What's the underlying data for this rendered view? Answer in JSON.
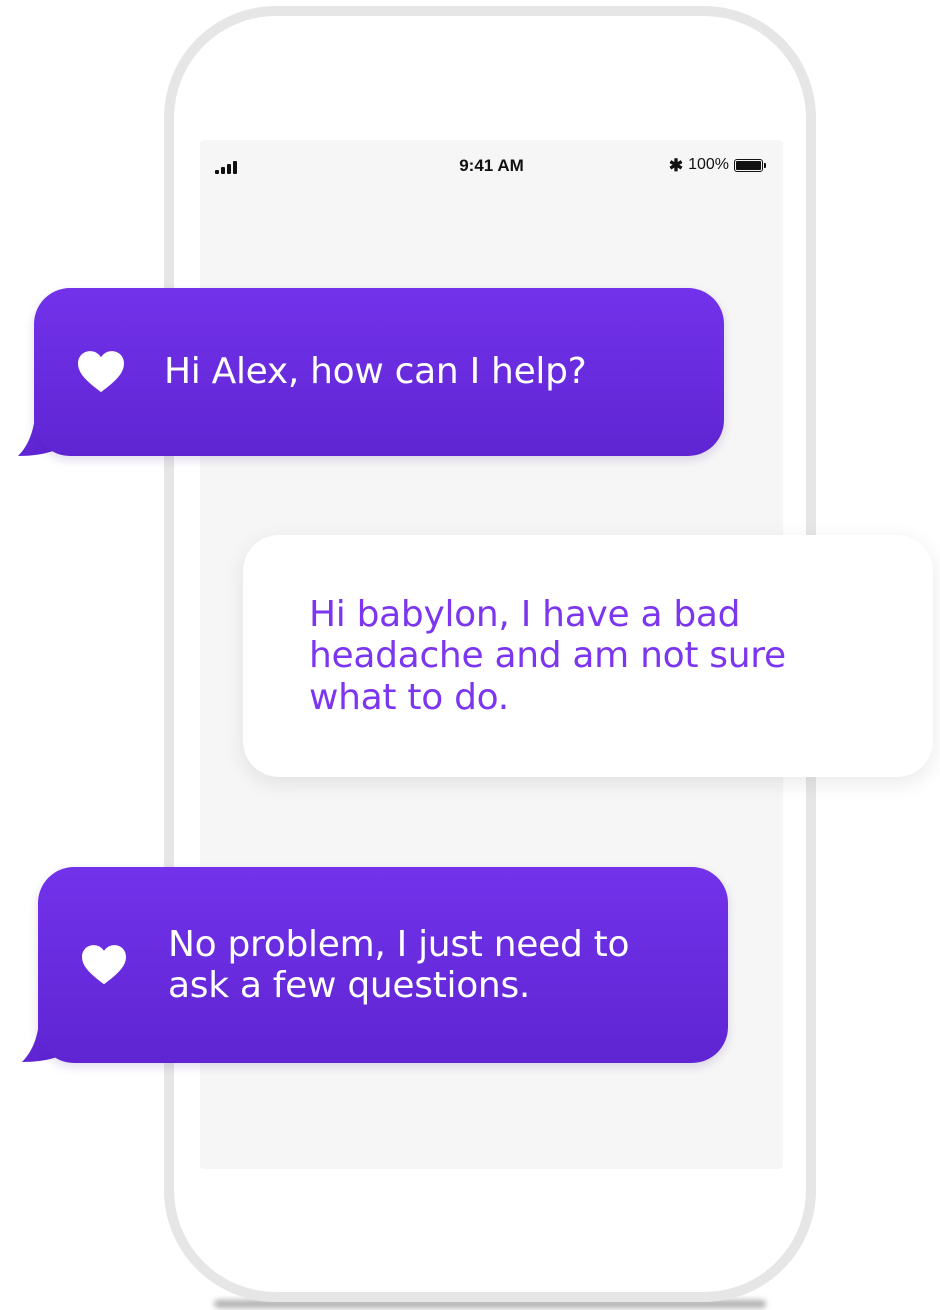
{
  "status_bar": {
    "time": "9:41 AM",
    "battery": "100%",
    "signal_icon": "signal-bars-icon",
    "bluetooth_icon": "bluetooth-icon",
    "battery_icon": "battery-icon",
    "bluetooth_glyph": "✱"
  },
  "conversation": {
    "messages": [
      {
        "sender": "assistant",
        "icon": "heart-icon",
        "text": "Hi Alex, how can I help?"
      },
      {
        "sender": "user",
        "text": "Hi babylon, I have a bad headache and am not sure what to do."
      },
      {
        "sender": "assistant",
        "icon": "heart-icon",
        "text": "No problem, I just need to ask a few questions."
      }
    ]
  },
  "colors": {
    "assistant_bubble_top": "#7232ea",
    "assistant_bubble_bottom": "#5f25d2",
    "user_text": "#7d36ef",
    "screen_background": "#f6f6f6",
    "phone_frame": "#e6e6e6"
  }
}
